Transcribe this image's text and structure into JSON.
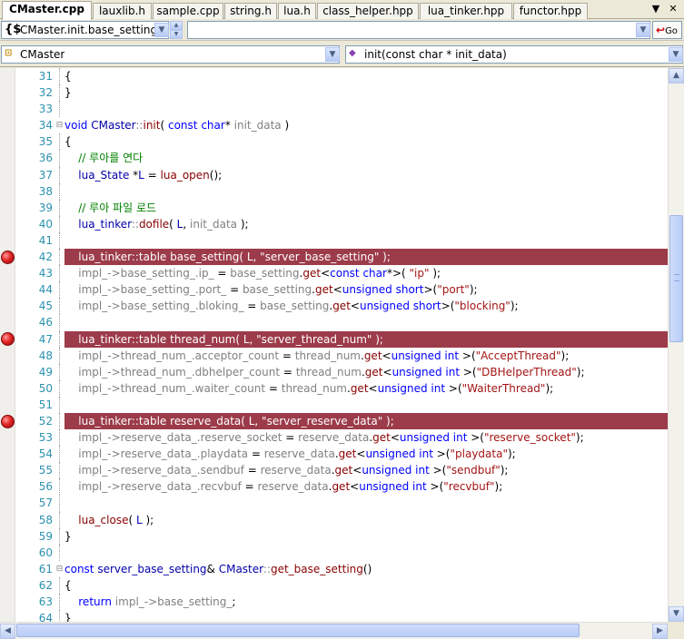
{
  "tabs": [
    {
      "label": "CMaster.cpp",
      "active": true
    },
    {
      "label": "lauxlib.h",
      "active": false
    },
    {
      "label": "sample.cpp",
      "active": false
    },
    {
      "label": "string.h",
      "active": false
    },
    {
      "label": "lua.h",
      "active": false
    },
    {
      "label": "class_helper.hpp",
      "active": false
    },
    {
      "label": "lua_tinker.hpp",
      "active": false
    },
    {
      "label": "functor.hpp",
      "active": false
    }
  ],
  "tab_controls": {
    "dropdown_icon": "▼",
    "close_icon": "✕"
  },
  "toolbar1": {
    "symbol_combo_value": "CMaster.init.base_setting",
    "symbol_icon": "{$",
    "find_combo_value": "",
    "go_label": "Go"
  },
  "toolbar2": {
    "class_combo_value": "CMaster",
    "member_combo_value": "init(const char * init_data)"
  },
  "editor": {
    "lines": [
      {
        "n": "31",
        "fold": "",
        "bp": false,
        "html": "<span class='tx'>{</span>"
      },
      {
        "n": "32",
        "fold": "",
        "bp": false,
        "html": "<span class='tx'>}</span>"
      },
      {
        "n": "33",
        "fold": "",
        "bp": false,
        "html": ""
      },
      {
        "n": "34",
        "fold": "⊟",
        "bp": false,
        "html": "<span class='kw'>void</span> <span class='ty'>CMaster</span><span class='gy'>::</span><span class='fn'>init</span>( <span class='kw'>const</span> <span class='kw'>char</span>* <span class='gy'>init_data</span> )"
      },
      {
        "n": "35",
        "fold": "",
        "bp": false,
        "html": "{"
      },
      {
        "n": "36",
        "fold": "",
        "bp": false,
        "html": "    <span class='cm'>// 루아를 연다</span>"
      },
      {
        "n": "37",
        "fold": "",
        "bp": false,
        "html": "    <span class='ty'>lua_State</span> *<span class='ty'>L</span> = <span class='fn'>lua_open</span>();"
      },
      {
        "n": "38",
        "fold": "",
        "bp": false,
        "html": ""
      },
      {
        "n": "39",
        "fold": "",
        "bp": false,
        "html": "    <span class='cm'>// 루아 파일 로드</span>"
      },
      {
        "n": "40",
        "fold": "",
        "bp": false,
        "html": "    <span class='ty'>lua_tinker</span><span class='gy'>::</span><span class='fn'>dofile</span>( <span class='ty'>L</span>, <span class='gy'>init_data</span> );"
      },
      {
        "n": "41",
        "fold": "",
        "bp": false,
        "html": ""
      },
      {
        "n": "42",
        "fold": "",
        "bp": true,
        "html": "    lua_tinker::table base_setting( L, \"server_base_setting\" );"
      },
      {
        "n": "43",
        "fold": "",
        "bp": false,
        "html": "    <span class='gy'>impl_-&gt;base_setting_.ip_</span> = <span class='gy'>base_setting</span>.<span class='fn'>get</span>&lt;<span class='kw'>const char</span>*&gt;( <span class='st'>\"ip\"</span> );"
      },
      {
        "n": "44",
        "fold": "",
        "bp": false,
        "html": "    <span class='gy'>impl_-&gt;base_setting_.port_</span> = <span class='gy'>base_setting</span>.<span class='fn'>get</span>&lt;<span class='kw'>unsigned short</span>&gt;(<span class='st'>\"port\"</span>);"
      },
      {
        "n": "45",
        "fold": "",
        "bp": false,
        "html": "    <span class='gy'>impl_-&gt;base_setting_.bloking_</span> = <span class='gy'>base_setting</span>.<span class='fn'>get</span>&lt;<span class='kw'>unsigned short</span>&gt;(<span class='st'>\"blocking\"</span>);"
      },
      {
        "n": "46",
        "fold": "",
        "bp": false,
        "html": ""
      },
      {
        "n": "47",
        "fold": "",
        "bp": true,
        "html": "    lua_tinker::table thread_num( L, \"server_thread_num\" );"
      },
      {
        "n": "48",
        "fold": "",
        "bp": false,
        "html": "    <span class='gy'>impl_-&gt;thread_num_.acceptor_count</span> = <span class='gy'>thread_num</span>.<span class='fn'>get</span>&lt;<span class='kw'>unsigned int</span> &gt;(<span class='st'>\"AcceptThread\"</span>);"
      },
      {
        "n": "49",
        "fold": "",
        "bp": false,
        "html": "    <span class='gy'>impl_-&gt;thread_num_.dbhelper_count</span> = <span class='gy'>thread_num</span>.<span class='fn'>get</span>&lt;<span class='kw'>unsigned int</span> &gt;(<span class='st'>\"DBHelperThread\"</span>);"
      },
      {
        "n": "50",
        "fold": "",
        "bp": false,
        "html": "    <span class='gy'>impl_-&gt;thread_num_.waiter_count</span> = <span class='gy'>thread_num</span>.<span class='fn'>get</span>&lt;<span class='kw'>unsigned int</span> &gt;(<span class='st'>\"WaiterThread\"</span>);"
      },
      {
        "n": "51",
        "fold": "",
        "bp": false,
        "html": ""
      },
      {
        "n": "52",
        "fold": "",
        "bp": true,
        "html": "    lua_tinker::table reserve_data( L, \"server_reserve_data\" );"
      },
      {
        "n": "53",
        "fold": "",
        "bp": false,
        "html": "    <span class='gy'>impl_-&gt;reserve_data_.reserve_socket</span> = <span class='gy'>reserve_data</span>.<span class='fn'>get</span>&lt;<span class='kw'>unsigned int</span> &gt;(<span class='st'>\"reserve_socket\"</span>);"
      },
      {
        "n": "54",
        "fold": "",
        "bp": false,
        "html": "    <span class='gy'>impl_-&gt;reserve_data_.playdata</span> = <span class='gy'>reserve_data</span>.<span class='fn'>get</span>&lt;<span class='kw'>unsigned int</span> &gt;(<span class='st'>\"playdata\"</span>);"
      },
      {
        "n": "55",
        "fold": "",
        "bp": false,
        "html": "    <span class='gy'>impl_-&gt;reserve_data_.sendbuf</span> = <span class='gy'>reserve_data</span>.<span class='fn'>get</span>&lt;<span class='kw'>unsigned int</span> &gt;(<span class='st'>\"sendbuf\"</span>);"
      },
      {
        "n": "56",
        "fold": "",
        "bp": false,
        "html": "    <span class='gy'>impl_-&gt;reserve_data_.recvbuf</span> = <span class='gy'>reserve_data</span>.<span class='fn'>get</span>&lt;<span class='kw'>unsigned int</span> &gt;(<span class='st'>\"recvbuf\"</span>);"
      },
      {
        "n": "57",
        "fold": "",
        "bp": false,
        "html": ""
      },
      {
        "n": "58",
        "fold": "",
        "bp": false,
        "html": "    <span class='fn'>lua_close</span>( <span class='ty'>L</span> );"
      },
      {
        "n": "59",
        "fold": "",
        "bp": false,
        "html": "}"
      },
      {
        "n": "60",
        "fold": "",
        "bp": false,
        "html": ""
      },
      {
        "n": "61",
        "fold": "⊟",
        "bp": false,
        "html": "<span class='kw'>const</span> <span class='ty'>server_base_setting</span>&amp; <span class='ty'>CMaster</span><span class='gy'>::</span><span class='fn'>get_base_setting</span>()"
      },
      {
        "n": "62",
        "fold": "",
        "bp": false,
        "html": "{"
      },
      {
        "n": "63",
        "fold": "",
        "bp": false,
        "html": "    <span class='kw'>return</span> <span class='gy'>impl_-&gt;base_setting_</span>;"
      },
      {
        "n": "64",
        "fold": "",
        "bp": false,
        "html": "}"
      }
    ]
  },
  "colors": {
    "breakpoint_line": "#9c3b4a",
    "line_numbers": "#2b91af",
    "comment": "#008000",
    "keyword": "#0000ff"
  }
}
